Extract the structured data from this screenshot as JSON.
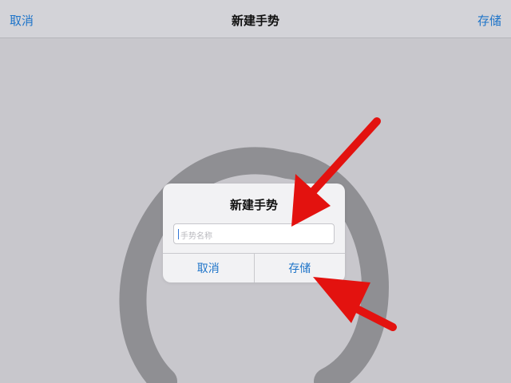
{
  "nav": {
    "cancel_label": "取消",
    "title": "新建手势",
    "save_label": "存储"
  },
  "dialog": {
    "title": "新建手势",
    "input_value": "",
    "input_placeholder": "手势名称",
    "cancel_label": "取消",
    "save_label": "存储"
  },
  "colors": {
    "accent": "#1e74c9",
    "background": "#c8c7cc",
    "gesture_stroke": "#8f8f93",
    "annotation_arrow": "#e3120f"
  },
  "icons": {
    "annotation_arrows": "red-arrow-icon"
  }
}
